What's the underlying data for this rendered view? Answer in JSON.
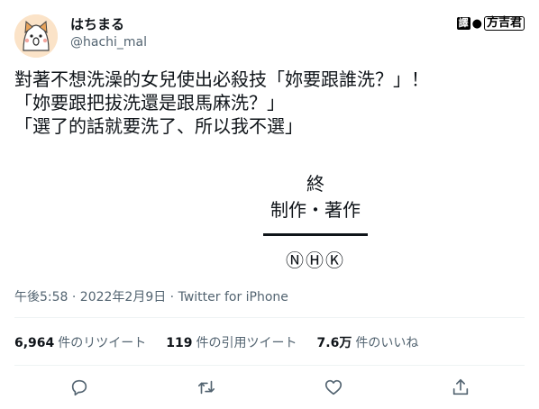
{
  "author": {
    "name": "はちまる",
    "handle": "@hachi_mal"
  },
  "translator_credit": {
    "badge1": "譯",
    "badge2": "方吉君"
  },
  "tweet": {
    "lines": [
      "對著不想洗澡的女兒使出必殺技「妳要跟誰洗？」！",
      "「妳要跟把拔洗還是跟馬麻洗？」",
      "「選了的話就要洗了、所以我不選」"
    ],
    "end_text": "終",
    "credit_text": "制作・著作",
    "nhk_text": "ⓃⒽⓀ"
  },
  "meta": {
    "timestamp": "午後5:58 · 2022年2月9日 · Twitter for iPhone"
  },
  "stats": {
    "retweets_count": "6,964",
    "retweets_label": "件のリツイート",
    "quotes_count": "119",
    "quotes_label": "件の引用ツイート",
    "likes_count": "7.6万",
    "likes_label": "件のいいね"
  },
  "actions": [
    "reply-icon",
    "retweet-icon",
    "like-icon",
    "share-icon"
  ]
}
